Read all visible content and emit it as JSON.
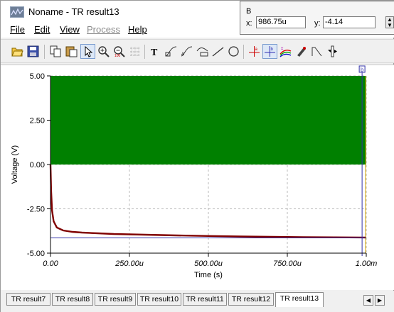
{
  "window": {
    "title": "Noname - TR result13"
  },
  "menu": {
    "items": [
      {
        "label": "File",
        "enabled": true
      },
      {
        "label": "Edit",
        "enabled": true
      },
      {
        "label": "View",
        "enabled": true
      },
      {
        "label": "Process",
        "enabled": false
      },
      {
        "label": "Help",
        "enabled": true
      }
    ]
  },
  "readout": {
    "cursor_name": "B",
    "x_label": "x:",
    "x_value": "986.75u",
    "y_label": "y:",
    "y_value": "-4.14"
  },
  "toolbar": {
    "icons": [
      "open-icon",
      "save-icon",
      "copy-icon",
      "paste-icon",
      "pointer-icon",
      "zoom-in-icon",
      "zoom-fit-icon",
      "grid-icon",
      "text-icon",
      "curve-icon",
      "curve-label-icon",
      "function-icon",
      "line-icon",
      "circle-icon",
      "cursor-a-icon",
      "cursor-b-icon",
      "curve-color-icon",
      "pen-icon",
      "marker-icon",
      "scroll-arrows-icon"
    ]
  },
  "chart_data": {
    "type": "line",
    "xlabel": "Time (s)",
    "ylabel": "Voltage (V)",
    "xlim": [
      0,
      1000
    ],
    "ylim": [
      -5,
      5
    ],
    "x_unit": "u",
    "x_ticks": [
      "0.00",
      "250.00u",
      "500.00u",
      "750.00u",
      "1.00m"
    ],
    "y_ticks": [
      "5.00",
      "2.50",
      "0.00",
      "-2.50",
      "-5.00"
    ],
    "grid": true,
    "series": [
      {
        "color": "#008000",
        "style": "square-wave",
        "description_values": {
          "high": 5,
          "low": 0,
          "x_end": 1000
        }
      },
      {
        "color": "#800000",
        "x": [
          0,
          2,
          5,
          10,
          20,
          40,
          70,
          100,
          150,
          200,
          300,
          400,
          500,
          600,
          700,
          800,
          900,
          1000
        ],
        "y": [
          0,
          -1.5,
          -2.6,
          -3.2,
          -3.55,
          -3.72,
          -3.8,
          -3.84,
          -3.88,
          -3.92,
          -3.96,
          -4.0,
          -4.03,
          -4.06,
          -4.08,
          -4.1,
          -4.11,
          -4.12
        ]
      }
    ],
    "cursor": {
      "name": "b",
      "x": 986.75,
      "y": -4.14,
      "color": "#3333aa"
    },
    "marker_line": {
      "x": 1000,
      "color": "#d4a600"
    }
  },
  "tabs": {
    "items": [
      "TR result7",
      "TR result8",
      "TR result9",
      "TR result10",
      "TR result11",
      "TR result12",
      "TR result13"
    ],
    "active": "TR result13",
    "left_arrow": "◀",
    "right_arrow": "▶"
  }
}
